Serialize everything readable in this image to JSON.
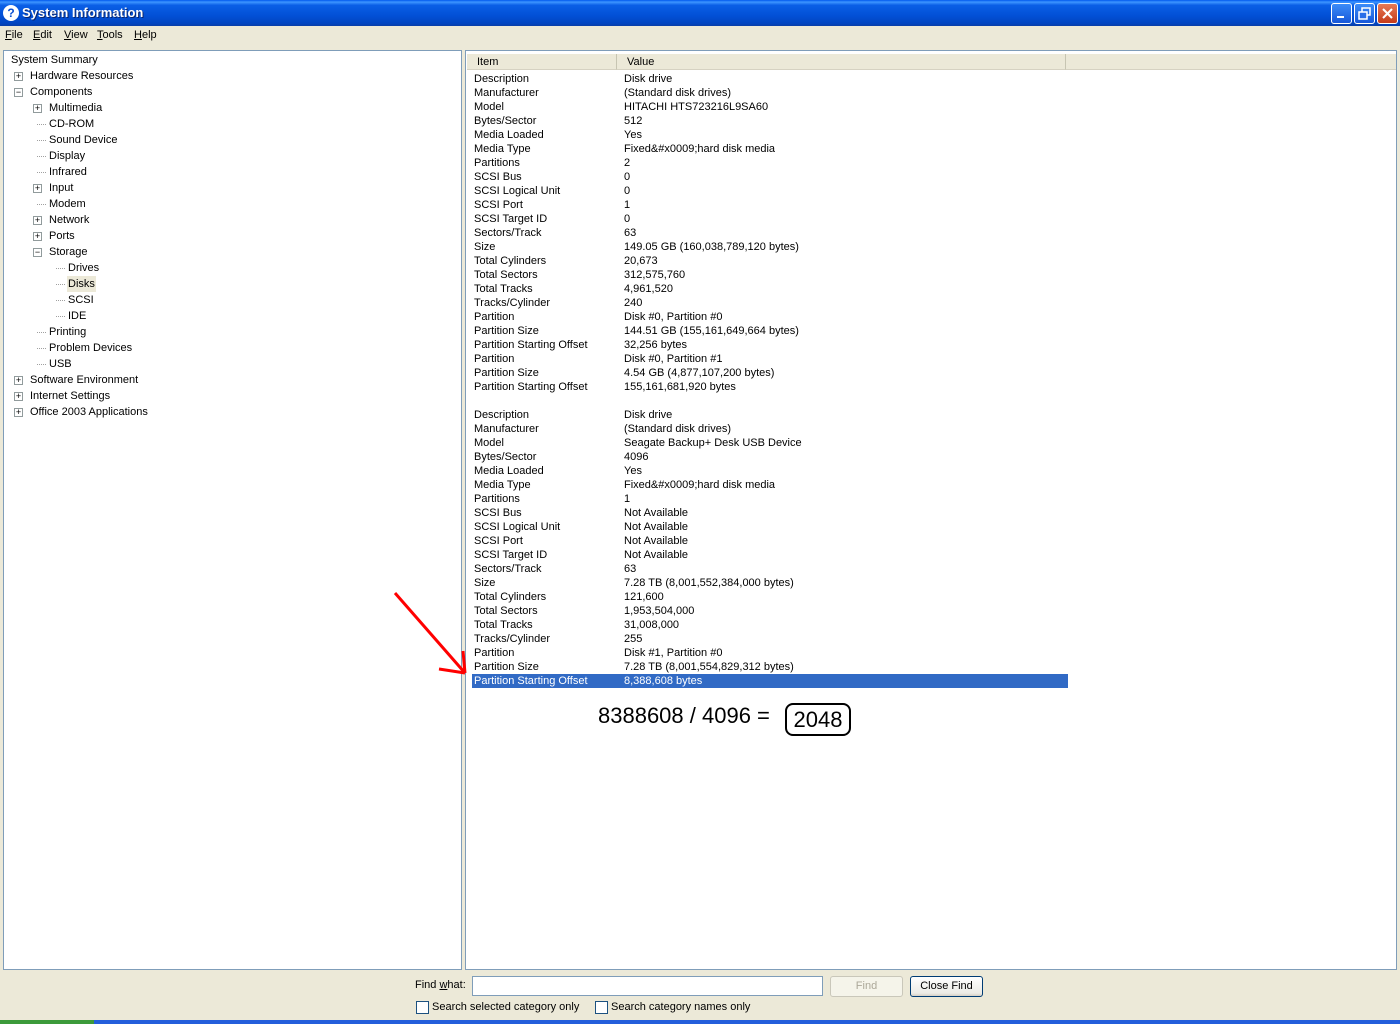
{
  "window": {
    "title": "System Information",
    "icon": "help-icon"
  },
  "menu": [
    {
      "key": "F",
      "rest": "ile"
    },
    {
      "key": "E",
      "rest": "dit"
    },
    {
      "key": "V",
      "rest": "iew"
    },
    {
      "key": "T",
      "rest": "ools"
    },
    {
      "key": "H",
      "rest": "elp"
    }
  ],
  "tree": [
    {
      "label": "System Summary",
      "level": 0,
      "expander": ""
    },
    {
      "label": "Hardware Resources",
      "level": 1,
      "expander": "+"
    },
    {
      "label": "Components",
      "level": 1,
      "expander": "-"
    },
    {
      "label": "Multimedia",
      "level": 2,
      "expander": "+"
    },
    {
      "label": "CD-ROM",
      "level": 2,
      "expander": ""
    },
    {
      "label": "Sound Device",
      "level": 2,
      "expander": ""
    },
    {
      "label": "Display",
      "level": 2,
      "expander": ""
    },
    {
      "label": "Infrared",
      "level": 2,
      "expander": ""
    },
    {
      "label": "Input",
      "level": 2,
      "expander": "+"
    },
    {
      "label": "Modem",
      "level": 2,
      "expander": ""
    },
    {
      "label": "Network",
      "level": 2,
      "expander": "+"
    },
    {
      "label": "Ports",
      "level": 2,
      "expander": "+"
    },
    {
      "label": "Storage",
      "level": 2,
      "expander": "-"
    },
    {
      "label": "Drives",
      "level": 3,
      "expander": ""
    },
    {
      "label": "Disks",
      "level": 3,
      "expander": "",
      "selected": true
    },
    {
      "label": "SCSI",
      "level": 3,
      "expander": ""
    },
    {
      "label": "IDE",
      "level": 3,
      "expander": ""
    },
    {
      "label": "Printing",
      "level": 2,
      "expander": ""
    },
    {
      "label": "Problem Devices",
      "level": 2,
      "expander": ""
    },
    {
      "label": "USB",
      "level": 2,
      "expander": ""
    },
    {
      "label": "Software Environment",
      "level": 1,
      "expander": "+"
    },
    {
      "label": "Internet Settings",
      "level": 1,
      "expander": "+"
    },
    {
      "label": "Office 2003 Applications",
      "level": 1,
      "expander": "+"
    }
  ],
  "columns": {
    "item": "Item",
    "value": "Value"
  },
  "rows": [
    [
      "Description",
      "Disk drive"
    ],
    [
      "Manufacturer",
      "(Standard disk drives)"
    ],
    [
      "Model",
      "HITACHI HTS723216L9SA60"
    ],
    [
      "Bytes/Sector",
      "512"
    ],
    [
      "Media Loaded",
      "Yes"
    ],
    [
      "Media Type",
      "Fixed&#x0009;hard disk media"
    ],
    [
      "Partitions",
      "2"
    ],
    [
      "SCSI Bus",
      "0"
    ],
    [
      "SCSI Logical Unit",
      "0"
    ],
    [
      "SCSI Port",
      "1"
    ],
    [
      "SCSI Target ID",
      "0"
    ],
    [
      "Sectors/Track",
      "63"
    ],
    [
      "Size",
      "149.05 GB (160,038,789,120 bytes)"
    ],
    [
      "Total Cylinders",
      "20,673"
    ],
    [
      "Total Sectors",
      "312,575,760"
    ],
    [
      "Total Tracks",
      "4,961,520"
    ],
    [
      "Tracks/Cylinder",
      "240"
    ],
    [
      "Partition",
      "Disk #0, Partition #0"
    ],
    [
      "Partition Size",
      "144.51 GB (155,161,649,664 bytes)"
    ],
    [
      "Partition Starting Offset",
      "32,256 bytes"
    ],
    [
      "Partition",
      "Disk #0, Partition #1"
    ],
    [
      "Partition Size",
      "4.54 GB (4,877,107,200 bytes)"
    ],
    [
      "Partition Starting Offset",
      "155,161,681,920 bytes"
    ],
    [
      "",
      ""
    ],
    [
      "Description",
      "Disk drive"
    ],
    [
      "Manufacturer",
      "(Standard disk drives)"
    ],
    [
      "Model",
      "Seagate Backup+  Desk USB Device"
    ],
    [
      "Bytes/Sector",
      "4096"
    ],
    [
      "Media Loaded",
      "Yes"
    ],
    [
      "Media Type",
      "Fixed&#x0009;hard disk media"
    ],
    [
      "Partitions",
      "1"
    ],
    [
      "SCSI Bus",
      "Not Available"
    ],
    [
      "SCSI Logical Unit",
      "Not Available"
    ],
    [
      "SCSI Port",
      "Not Available"
    ],
    [
      "SCSI Target ID",
      "Not Available"
    ],
    [
      "Sectors/Track",
      "63"
    ],
    [
      "Size",
      "7.28 TB (8,001,552,384,000 bytes)"
    ],
    [
      "Total Cylinders",
      "121,600"
    ],
    [
      "Total Sectors",
      "1,953,504,000"
    ],
    [
      "Total Tracks",
      "31,008,000"
    ],
    [
      "Tracks/Cylinder",
      "255"
    ],
    [
      "Partition",
      "Disk #1, Partition #0"
    ],
    [
      "Partition Size",
      "7.28 TB (8,001,554,829,312 bytes)"
    ],
    [
      "Partition Starting Offset",
      "8,388,608 bytes"
    ]
  ],
  "selected_row": 43,
  "annotation": {
    "equation": "8388608 / 4096 =",
    "result": "2048",
    "arrow_color": "#FF0000"
  },
  "find": {
    "label_key": "w",
    "label_pre": "Find ",
    "label_post": "hat:",
    "value": "",
    "find_button": "Find",
    "close_button": "Close Find",
    "chk_selected": "Search selected category only",
    "chk_names": "Search category names only"
  },
  "colors": {
    "selection": "#316AC5",
    "titlebar": "#0A5FE6"
  }
}
